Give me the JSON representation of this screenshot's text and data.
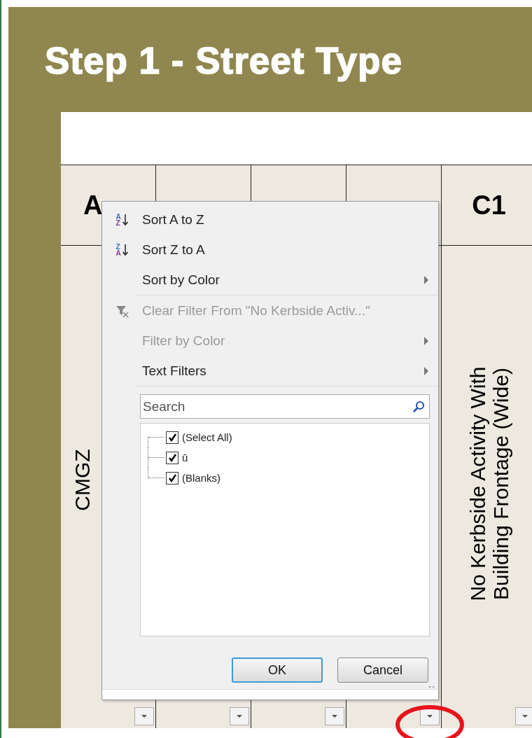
{
  "title": "Step 1 - Street Type",
  "columns": [
    {
      "heading": "A",
      "cell": "CMGZ",
      "circled": false
    },
    {
      "circled": false
    },
    {
      "circled": false
    },
    {
      "circled": true
    },
    {
      "heading": "C1",
      "cell": "No Kerbside Activity With Building Frontage (Wide)",
      "circled": false
    }
  ],
  "filter_menu": {
    "items": [
      {
        "kind": "sort",
        "icon_letters": [
          "A",
          "Z"
        ],
        "label": "Sort A to Z",
        "disabled": false,
        "submenu": false
      },
      {
        "kind": "sort",
        "icon_letters": [
          "Z",
          "A"
        ],
        "label": "Sort Z to A",
        "disabled": false,
        "submenu": false
      },
      {
        "kind": "plain",
        "label": "Sort by Color",
        "disabled": false,
        "submenu": true
      },
      {
        "kind": "clear-filter",
        "label": "Clear Filter From \"No Kerbside Activ...\"",
        "disabled": true,
        "submenu": false
      },
      {
        "kind": "plain",
        "label": "Filter by Color",
        "disabled": true,
        "submenu": true
      },
      {
        "kind": "plain",
        "label": "Text Filters",
        "disabled": false,
        "submenu": true
      }
    ],
    "search": {
      "placeholder": "Search"
    },
    "values": [
      {
        "label": "(Select All)",
        "checked": true
      },
      {
        "label": "ū",
        "checked": true
      },
      {
        "label": "(Blanks)",
        "checked": true
      }
    ],
    "buttons": [
      {
        "label": "OK",
        "selected": true
      },
      {
        "label": "Cancel",
        "selected": false
      }
    ]
  }
}
